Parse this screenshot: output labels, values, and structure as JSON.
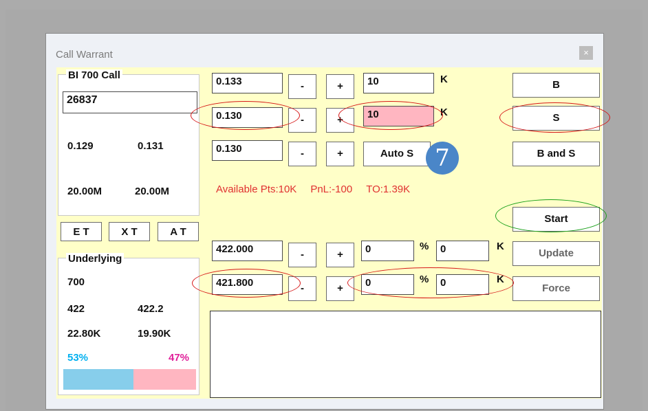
{
  "window": {
    "title": "Call Warrant",
    "close_glyph": "×"
  },
  "left_panel": {
    "group_title": "BI 700 Call",
    "code_value": "26837",
    "bid": "0.129",
    "ask": "0.131",
    "bid_vol": "20.00M",
    "ask_vol": "20.00M",
    "mode_buttons": [
      "E T",
      "X T",
      "A T"
    ]
  },
  "underlying": {
    "group_title": "Underlying",
    "code": "700",
    "bid": "422",
    "ask": "422.2",
    "bid_vol": "22.80K",
    "ask_vol": "19.90K",
    "bid_pct": "53%",
    "ask_pct": "47%",
    "bid_pct_value": 53,
    "ask_pct_value": 47
  },
  "order_rows": [
    {
      "price": "0.133",
      "minus": "-",
      "plus": "+",
      "qty": "10",
      "unit": "K",
      "action": "B"
    },
    {
      "price": "0.130",
      "minus": "-",
      "plus": "+",
      "qty": "10",
      "unit": "K",
      "action": "S"
    },
    {
      "price": "0.130",
      "minus": "-",
      "plus": "+",
      "auto_label": "Auto S",
      "action": "B and S"
    }
  ],
  "status": {
    "available": "Available Pts:10K",
    "pnl": "PnL:-100",
    "turnover": "TO:1.39K"
  },
  "start_button": "Start",
  "stock_rows": [
    {
      "price": "422.000",
      "minus": "-",
      "plus": "+",
      "pct": "0",
      "pct_unit": "%",
      "k": "0",
      "k_unit": "K",
      "action": "Update"
    },
    {
      "price": "421.800",
      "minus": "-",
      "plus": "+",
      "pct": "0",
      "pct_unit": "%",
      "k": "0",
      "k_unit": "K",
      "action": "Force"
    }
  ],
  "annotation_number": "7",
  "log_text": "",
  "colors": {
    "highlight_field": "#ffb6c1",
    "bid_bar": "#87ceeb",
    "ask_bar": "#ffb6c1",
    "bid_pct_text": "#00b0f0",
    "ask_pct_text": "#e0209a",
    "status_text": "#e03030",
    "panel_bg": "#ffffc8"
  }
}
